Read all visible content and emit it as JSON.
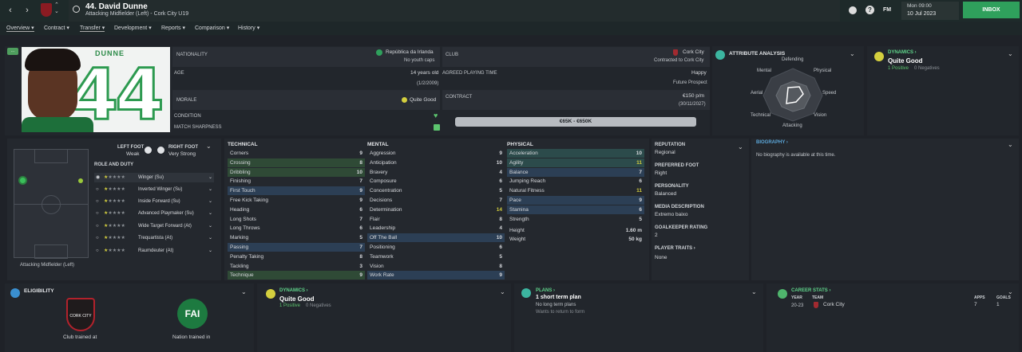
{
  "header": {
    "player_title": "44. David Dunne",
    "player_subtitle": "Attacking Midfielder (Left) - Cork City U19",
    "time": "Mon 09:00",
    "date": "10 Jul 2023",
    "inbox_label": "INBOX",
    "fm_label": "FM"
  },
  "tabs": [
    "Overview",
    "Contract",
    "Transfer",
    "Development",
    "Reports",
    "Comparison",
    "History"
  ],
  "profile": {
    "badge": "...",
    "shirt_name": "DUNNE",
    "shirt_number": "44"
  },
  "info": {
    "nationality_label": "NATIONALITY",
    "nationality": "República da Irlanda",
    "youth_caps": "No youth caps",
    "age_label": "AGE",
    "age": "14 years old",
    "dob": "(1/2/2009)",
    "morale_label": "MORALE",
    "morale": "Quite Good",
    "condition_label": "CONDITION",
    "sharpness_label": "MATCH SHARPNESS",
    "club_label": "CLUB",
    "club": "Cork City",
    "club_sub": "Contracted to Cork City",
    "playing_time_label": "AGREED PLAYING TIME",
    "playing_time": "Happy",
    "prospect": "Future Prospect",
    "contract_label": "CONTRACT",
    "wage": "€150 p/m",
    "expiry": "(30/11/2027)",
    "value_range": "€65K - €650K"
  },
  "attribute_analysis": {
    "title": "ATTRIBUTE ANALYSIS",
    "labels": {
      "defending": "Defending",
      "physical": "Physical",
      "speed": "Speed",
      "vision": "Vision",
      "attacking": "Attacking",
      "technical": "Technical",
      "aerial": "Aerial",
      "mental": "Mental"
    }
  },
  "dynamics": {
    "title": "DYNAMICS",
    "value": "Quite Good",
    "positive": "1 Positive",
    "negatives": "0 Negatives"
  },
  "positions": {
    "position_label": "Attacking Midfielder (Left)",
    "left_foot_label": "LEFT FOOT",
    "left_foot": "Weak",
    "right_foot_label": "RIGHT FOOT",
    "right_foot": "Very Strong",
    "role_title": "ROLE AND DUTY",
    "roles": [
      "Winger (Su)",
      "Inverted Winger (Su)",
      "Inside Forward (Su)",
      "Advanced Playmaker (Su)",
      "Wide Target Forward (At)",
      "Trequartista (At)",
      "Raumdeuter (At)"
    ]
  },
  "technical": {
    "title": "TECHNICAL",
    "rows": [
      [
        "Corners",
        "9"
      ],
      [
        "Crossing",
        "8"
      ],
      [
        "Dribbling",
        "10"
      ],
      [
        "Finishing",
        "7"
      ],
      [
        "First Touch",
        "9"
      ],
      [
        "Free Kick Taking",
        "9"
      ],
      [
        "Heading",
        "6"
      ],
      [
        "Long Shots",
        "7"
      ],
      [
        "Long Throws",
        "6"
      ],
      [
        "Marking",
        "5"
      ],
      [
        "Passing",
        "7"
      ],
      [
        "Penalty Taking",
        "8"
      ],
      [
        "Tackling",
        "3"
      ],
      [
        "Technique",
        "9"
      ]
    ]
  },
  "mental": {
    "title": "MENTAL",
    "rows": [
      [
        "Aggression",
        "9"
      ],
      [
        "Anticipation",
        "10"
      ],
      [
        "Bravery",
        "4"
      ],
      [
        "Composure",
        "6"
      ],
      [
        "Concentration",
        "5"
      ],
      [
        "Decisions",
        "7"
      ],
      [
        "Determination",
        "14"
      ],
      [
        "Flair",
        "8"
      ],
      [
        "Leadership",
        "4"
      ],
      [
        "Off The Ball",
        "10"
      ],
      [
        "Positioning",
        "6"
      ],
      [
        "Teamwork",
        "5"
      ],
      [
        "Vision",
        "8"
      ],
      [
        "Work Rate",
        "9"
      ]
    ]
  },
  "physical": {
    "title": "PHYSICAL",
    "rows": [
      [
        "Acceleration",
        "10"
      ],
      [
        "Agility",
        "11"
      ],
      [
        "Balance",
        "7"
      ],
      [
        "Jumping Reach",
        "6"
      ],
      [
        "Natural Fitness",
        "11"
      ],
      [
        "Pace",
        "9"
      ],
      [
        "Stamina",
        "6"
      ],
      [
        "Strength",
        "5"
      ]
    ],
    "height_label": "Height",
    "height": "1.60 m",
    "weight_label": "Weight",
    "weight": "50 kg"
  },
  "reputation": {
    "title": "REPUTATION",
    "value": "Regional",
    "foot_title": "PREFERRED FOOT",
    "foot": "Right",
    "personality_title": "PERSONALITY",
    "personality": "Balanced",
    "media_title": "MEDIA DESCRIPTION",
    "media": "Extremo baixo",
    "gk_title": "GOALKEEPER RATING",
    "gk": "2",
    "traits_title": "PLAYER TRAITS",
    "traits": "None"
  },
  "biography": {
    "title": "BIOGRAPHY",
    "text": "No biography is available at this time."
  },
  "eligibility": {
    "title": "ELIGIBILITY",
    "club_trained": "Club trained at",
    "nation_trained": "Nation trained in",
    "club_crest": "CORK CITY",
    "nation_crest": "FAI"
  },
  "dynamics2": {
    "title": "DYNAMICS",
    "value": "Quite Good",
    "positive": "1 Positive",
    "negatives": "0 Negatives"
  },
  "plans": {
    "title": "PLANS",
    "value": "1 short term plan",
    "line1": "No long term plans",
    "line2": "Wants to return to form"
  },
  "career": {
    "title": "CAREER STATS",
    "year_h": "YEAR",
    "team_h": "TEAM",
    "apps_h": "APPS",
    "goals_h": "GOALS",
    "year": "20-23",
    "team": "Cork City",
    "apps": "7",
    "goals": "1"
  },
  "colors": {
    "accent": "#2fa05c",
    "green": "#5cc46e",
    "yellow": "#d4cf3e"
  }
}
